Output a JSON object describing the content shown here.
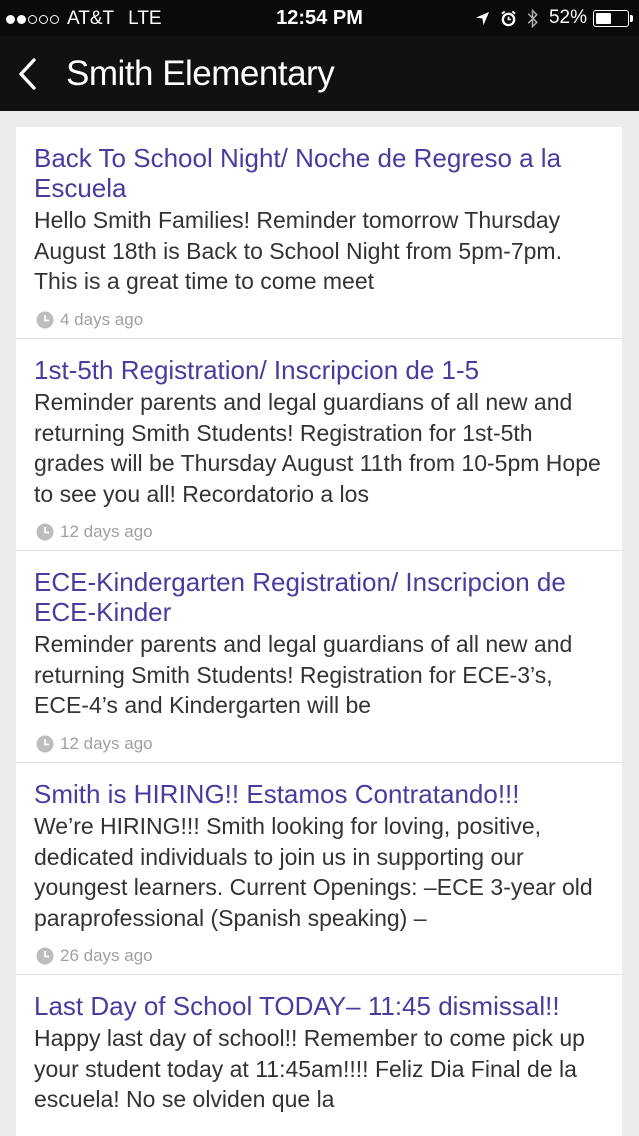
{
  "status_bar": {
    "carrier": "AT&T",
    "network": "LTE",
    "signal_bars_filled": 2,
    "signal_bars_total": 5,
    "time": "12:54 PM",
    "battery_percent": "52%",
    "battery_level": 0.52
  },
  "nav": {
    "title": "Smith Elementary"
  },
  "news": [
    {
      "title": "Back To School Night/ Noche de Regreso a la Escuela",
      "body": "Hello Smith Families! Reminder tomorrow Thursday August 18th is Back to School Night from 5pm-7pm. This is a great time to come meet",
      "time_ago": "4 days ago"
    },
    {
      "title": "1st-5th Registration/ Inscripcion de 1-5",
      "body": "Reminder parents and legal guardians of all new and returning Smith Students! Registration for 1st-5th grades will be Thursday August 11th from 10-5pm Hope to see you all! Recordatorio a los",
      "time_ago": "12 days ago"
    },
    {
      "title": "ECE-Kindergarten Registration/ Inscripcion de ECE-Kinder",
      "body": "Reminder parents and legal guardians of all new and returning Smith Students! Registration for ECE-3’s, ECE-4’s and Kindergarten will be",
      "time_ago": "12 days ago"
    },
    {
      "title": "Smith is HIRING!! Estamos Contratando!!!",
      "body": "We’re HIRING!!! Smith looking for loving, positive, dedicated individuals to join us in supporting our youngest learners. Current Openings: –ECE 3-year old paraprofessional (Spanish speaking) –",
      "time_ago": "26 days ago"
    },
    {
      "title": "Last Day of School TODAY– 11:45 dismissal!!",
      "body": "Happy last day of school!! Remember to come pick up your student today at 11:45am!!!! Feliz Dia Final de la escuela! No se olviden que la",
      "time_ago": ""
    }
  ]
}
